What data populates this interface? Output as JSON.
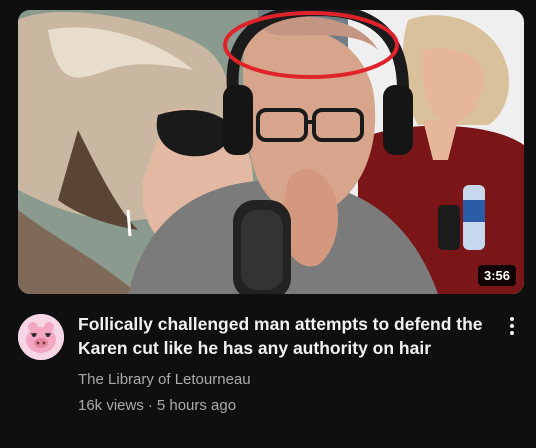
{
  "video": {
    "duration": "3:56",
    "title": "Follically challenged man attempts to defend the Karen cut like he has any authority on hair",
    "channel": "The Library of Letourneau",
    "views": "16k views",
    "separator": "·",
    "age": "5 hours ago"
  },
  "thumbnail": {
    "highlight_color": "#e0232b"
  },
  "icons": {
    "menu": "more-vert-icon",
    "avatar": "pig-avatar-icon"
  }
}
